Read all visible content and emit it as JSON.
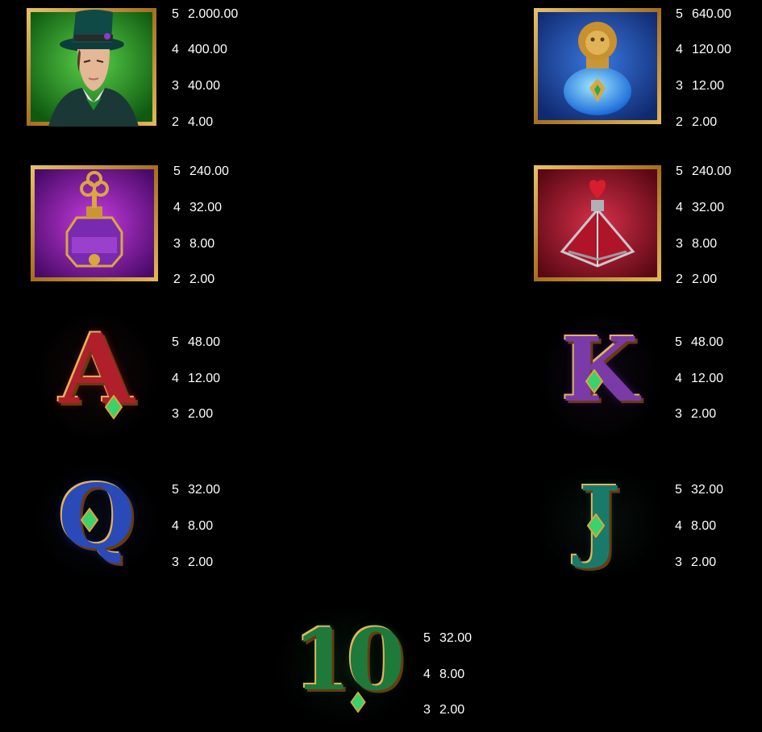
{
  "symbols": [
    {
      "name": "top-hat-man",
      "icon": "top-hat-man-icon",
      "pays": [
        {
          "count": "5",
          "value": "2.000.00"
        },
        {
          "count": "4",
          "value": "400.00"
        },
        {
          "count": "3",
          "value": "40.00"
        },
        {
          "count": "2",
          "value": "4.00"
        }
      ]
    },
    {
      "name": "lion-potion",
      "icon": "lion-potion-icon",
      "pays": [
        {
          "count": "5",
          "value": "640.00"
        },
        {
          "count": "4",
          "value": "120.00"
        },
        {
          "count": "3",
          "value": "12.00"
        },
        {
          "count": "2",
          "value": "2.00"
        }
      ]
    },
    {
      "name": "purple-potion",
      "icon": "clover-key-potion-icon",
      "pays": [
        {
          "count": "5",
          "value": "240.00"
        },
        {
          "count": "4",
          "value": "32.00"
        },
        {
          "count": "3",
          "value": "8.00"
        },
        {
          "count": "2",
          "value": "2.00"
        }
      ]
    },
    {
      "name": "heart-potion",
      "icon": "heart-potion-icon",
      "pays": [
        {
          "count": "5",
          "value": "240.00"
        },
        {
          "count": "4",
          "value": "32.00"
        },
        {
          "count": "3",
          "value": "8.00"
        },
        {
          "count": "2",
          "value": "2.00"
        }
      ]
    },
    {
      "name": "ace",
      "icon": "letter-a-icon",
      "glyph": "A",
      "pays": [
        {
          "count": "5",
          "value": "48.00"
        },
        {
          "count": "4",
          "value": "12.00"
        },
        {
          "count": "3",
          "value": "2.00"
        }
      ]
    },
    {
      "name": "king",
      "icon": "letter-k-icon",
      "glyph": "K",
      "pays": [
        {
          "count": "5",
          "value": "48.00"
        },
        {
          "count": "4",
          "value": "12.00"
        },
        {
          "count": "3",
          "value": "2.00"
        }
      ]
    },
    {
      "name": "queen",
      "icon": "letter-q-icon",
      "glyph": "Q",
      "pays": [
        {
          "count": "5",
          "value": "32.00"
        },
        {
          "count": "4",
          "value": "8.00"
        },
        {
          "count": "3",
          "value": "2.00"
        }
      ]
    },
    {
      "name": "jack",
      "icon": "letter-j-icon",
      "glyph": "J",
      "pays": [
        {
          "count": "5",
          "value": "32.00"
        },
        {
          "count": "4",
          "value": "8.00"
        },
        {
          "count": "3",
          "value": "2.00"
        }
      ]
    },
    {
      "name": "ten",
      "icon": "number-10-icon",
      "glyph": "10",
      "pays": [
        {
          "count": "5",
          "value": "32.00"
        },
        {
          "count": "4",
          "value": "8.00"
        },
        {
          "count": "3",
          "value": "2.00"
        }
      ]
    }
  ],
  "colors": {
    "background": "#000000",
    "frame_gold": "#b8862e",
    "green_tile": "#1f8a1f",
    "blue_tile": "#1d3f9a",
    "purple_tile": "#7b1a9a",
    "red_tile": "#8e1428"
  }
}
